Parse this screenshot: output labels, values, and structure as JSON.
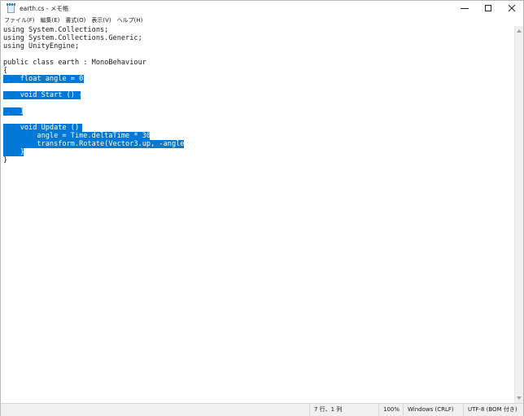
{
  "window": {
    "title": "earth.cs - メモ帳",
    "controls": {
      "minimize": "minimize",
      "maximize": "maximize",
      "close": "close"
    }
  },
  "menu": {
    "items": [
      {
        "label": "ファイル(F)"
      },
      {
        "label": "編集(E)"
      },
      {
        "label": "書式(O)"
      },
      {
        "label": "表示(V)"
      },
      {
        "label": "ヘルプ(H)"
      }
    ]
  },
  "editor": {
    "lines": [
      {
        "text": "using System.Collections;",
        "selected": false
      },
      {
        "text": "using System.Collections.Generic;",
        "selected": false
      },
      {
        "text": "using UnityEngine;",
        "selected": false
      },
      {
        "text": "",
        "selected": false
      },
      {
        "text": "public class earth : MonoBehaviour",
        "selected": false
      },
      {
        "text": "{",
        "selected": false
      },
      {
        "text": "    float angle = 0;",
        "selected": true
      },
      {
        "text": "",
        "selected": false
      },
      {
        "text": "    void Start () {",
        "selected": true
      },
      {
        "text": "",
        "selected": false
      },
      {
        "text": "    }",
        "selected": true
      },
      {
        "text": "",
        "selected": false
      },
      {
        "text": "    void Update () {",
        "selected": true
      },
      {
        "text": "        angle = Time.deltaTime * 30;",
        "selected": true
      },
      {
        "text": "        transform.Rotate(Vector3.up, -angle);",
        "selected": true
      },
      {
        "text": "    }",
        "selected": true
      },
      {
        "text": "}",
        "selected": false
      }
    ]
  },
  "statusbar": {
    "position": "7 行、1 列",
    "zoom": "100%",
    "line_ending": "Windows (CRLF)",
    "encoding": "UTF-8 (BOM 付き)"
  },
  "colors": {
    "selection": "#0078d7",
    "selection_text": "#ffffff"
  }
}
